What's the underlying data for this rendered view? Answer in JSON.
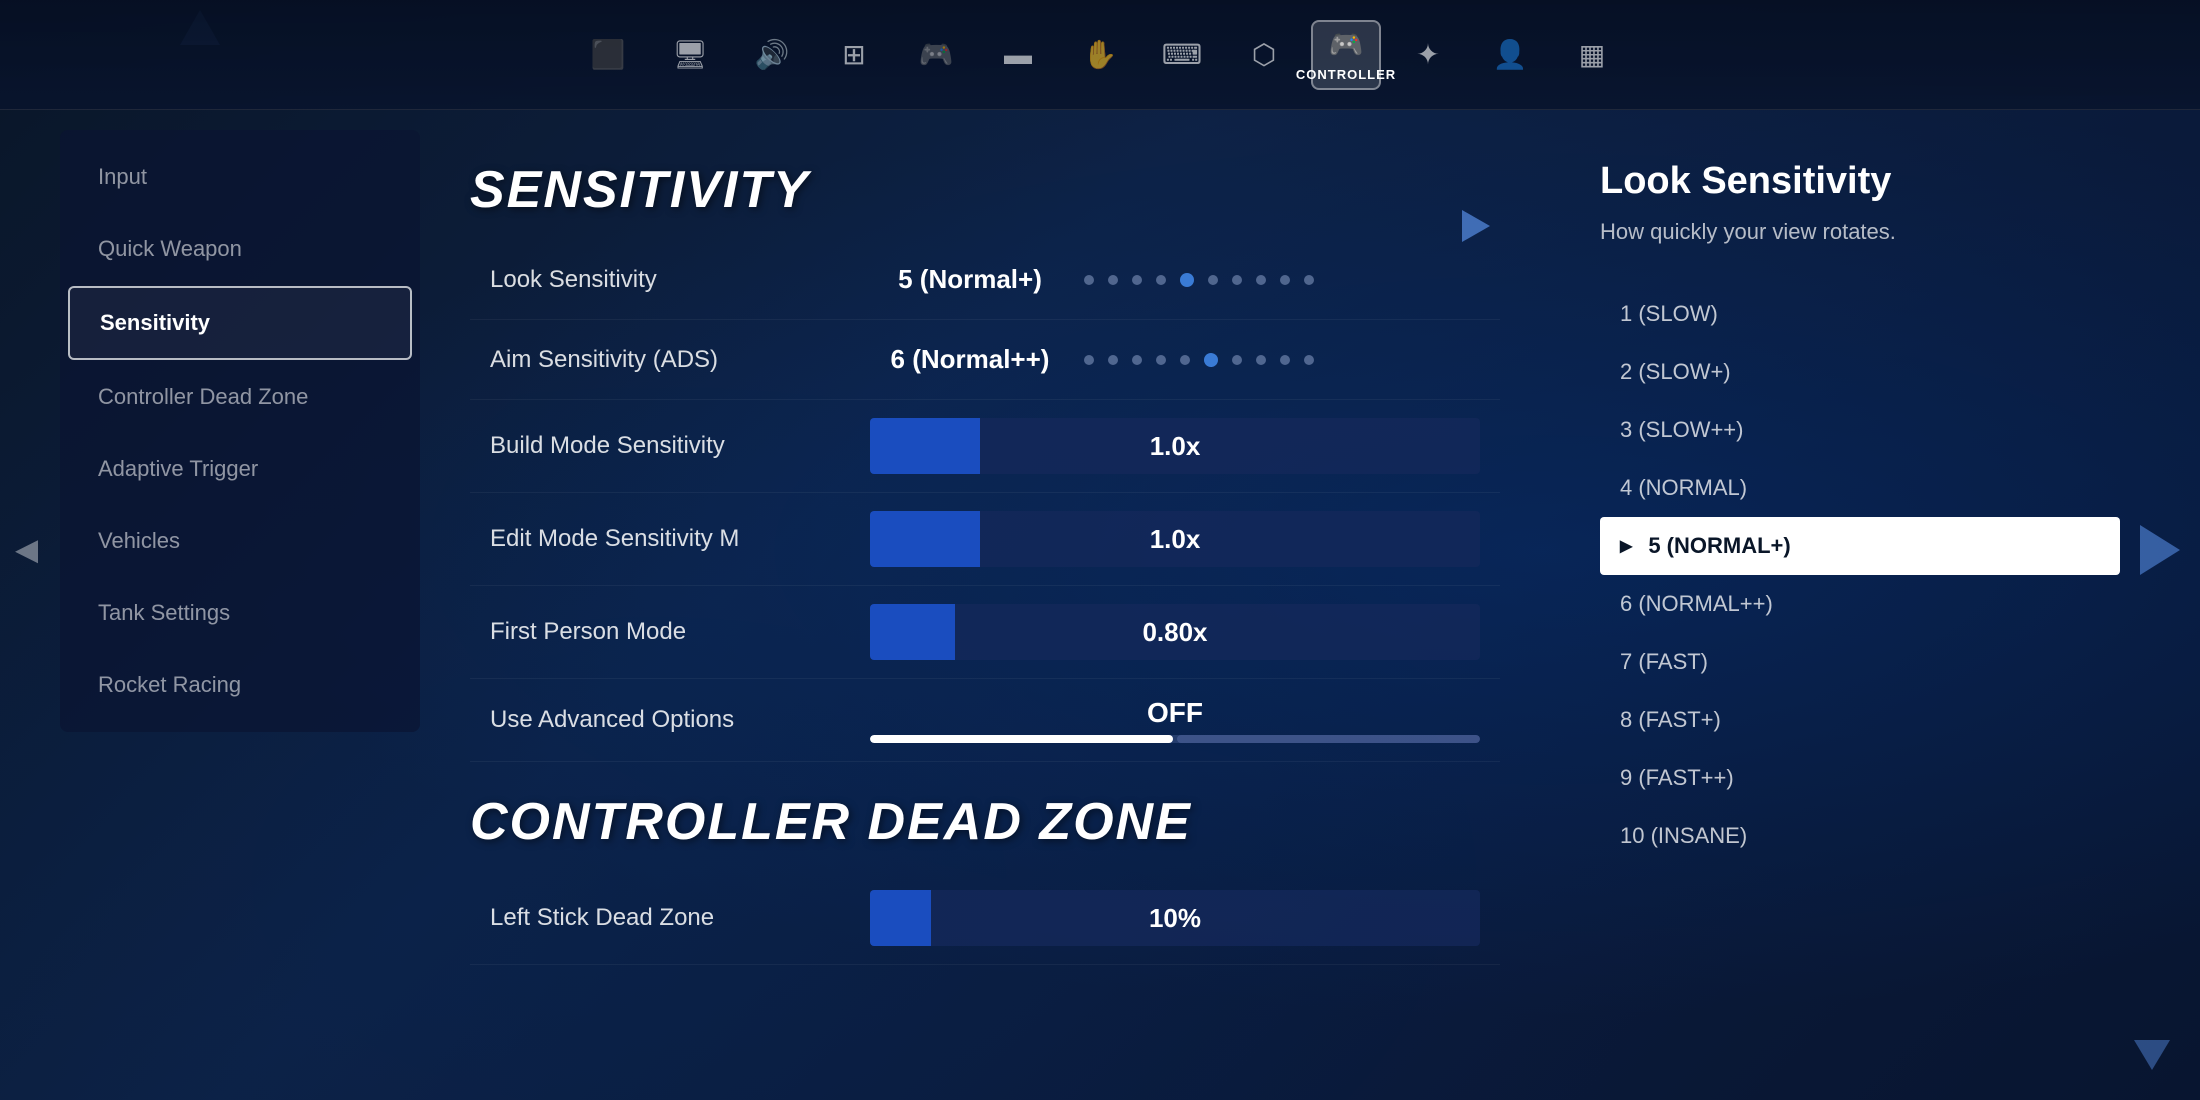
{
  "topNav": {
    "icons": [
      {
        "name": "input-icon",
        "symbol": "⬛",
        "label": "",
        "active": false
      },
      {
        "name": "display-icon",
        "symbol": "🖥",
        "label": "",
        "active": false
      },
      {
        "name": "audio-icon",
        "symbol": "🔊",
        "label": "",
        "active": false
      },
      {
        "name": "gameplay-icon",
        "symbol": "⊞",
        "label": "",
        "active": false
      },
      {
        "name": "controller-top-icon",
        "symbol": "🎮",
        "label": "",
        "active": false
      },
      {
        "name": "window-icon",
        "symbol": "▬",
        "label": "",
        "active": false
      },
      {
        "name": "touch-icon",
        "symbol": "✋",
        "label": "",
        "active": false
      },
      {
        "name": "keyboard-icon",
        "symbol": "⌨",
        "label": "",
        "active": false
      },
      {
        "name": "network-icon",
        "symbol": "⬡",
        "label": "",
        "active": false
      },
      {
        "name": "controller-icon",
        "symbol": "🎮",
        "label": "CONTROLLER",
        "active": true
      },
      {
        "name": "extras-icon",
        "symbol": "✦",
        "label": "",
        "active": false
      },
      {
        "name": "account-icon",
        "symbol": "👤",
        "label": "",
        "active": false
      },
      {
        "name": "misc-icon",
        "symbol": "▦",
        "label": "",
        "active": false
      }
    ]
  },
  "sidebar": {
    "items": [
      {
        "id": "input",
        "label": "Input",
        "active": false
      },
      {
        "id": "quick-weapon",
        "label": "Quick Weapon",
        "active": false
      },
      {
        "id": "sensitivity",
        "label": "Sensitivity",
        "active": true
      },
      {
        "id": "controller-dead-zone",
        "label": "Controller Dead Zone",
        "active": false
      },
      {
        "id": "adaptive-trigger",
        "label": "Adaptive Trigger",
        "active": false
      },
      {
        "id": "vehicles",
        "label": "Vehicles",
        "active": false
      },
      {
        "id": "tank-settings",
        "label": "Tank Settings",
        "active": false
      },
      {
        "id": "rocket-racing",
        "label": "Rocket Racing",
        "active": false
      }
    ]
  },
  "mainContent": {
    "sensitivitySection": {
      "heading": "SENSITIVITY",
      "settings": [
        {
          "id": "look-sensitivity",
          "label": "Look Sensitivity",
          "type": "dot-slider",
          "value": "5 (Normal+)",
          "dots": 10,
          "activeDot": 5
        },
        {
          "id": "aim-sensitivity",
          "label": "Aim Sensitivity (ADS)",
          "type": "dot-slider",
          "value": "6 (Normal++)",
          "dots": 10,
          "activeDot": 6
        },
        {
          "id": "build-mode-sensitivity",
          "label": "Build Mode Sensitivity",
          "type": "bar-slider",
          "value": "1.0x",
          "fillPercent": 18
        },
        {
          "id": "edit-mode-sensitivity",
          "label": "Edit Mode Sensitivity M",
          "type": "bar-slider",
          "value": "1.0x",
          "fillPercent": 18
        },
        {
          "id": "first-person-mode",
          "label": "First Person Mode",
          "type": "bar-slider",
          "value": "0.80x",
          "fillPercent": 14
        },
        {
          "id": "use-advanced-options",
          "label": "Use Advanced Options",
          "type": "toggle",
          "value": "OFF"
        }
      ]
    },
    "controllerDeadZoneSection": {
      "heading": "CONTROLLER DEAD ZONE",
      "settings": [
        {
          "id": "left-stick-dead-zone",
          "label": "Left Stick Dead Zone",
          "type": "bar-slider",
          "value": "10%",
          "fillPercent": 10
        }
      ]
    }
  },
  "rightPanel": {
    "title": "Look Sensitivity",
    "description": "How quickly your view rotates.",
    "options": [
      {
        "value": "1 (SLOW)",
        "selected": false
      },
      {
        "value": "2 (SLOW+)",
        "selected": false
      },
      {
        "value": "3 (SLOW++)",
        "selected": false
      },
      {
        "value": "4 (NORMAL)",
        "selected": false
      },
      {
        "value": "5 (NORMAL+)",
        "selected": true
      },
      {
        "value": "6 (NORMAL++)",
        "selected": false
      },
      {
        "value": "7 (FAST)",
        "selected": false
      },
      {
        "value": "8 (FAST+)",
        "selected": false
      },
      {
        "value": "9 (FAST++)",
        "selected": false
      },
      {
        "value": "10 (INSANE)",
        "selected": false
      }
    ]
  },
  "colors": {
    "accent": "#1a4dbf",
    "active": "#ffffff",
    "selected_bg": "#ffffff",
    "selected_text": "#0a1628"
  }
}
